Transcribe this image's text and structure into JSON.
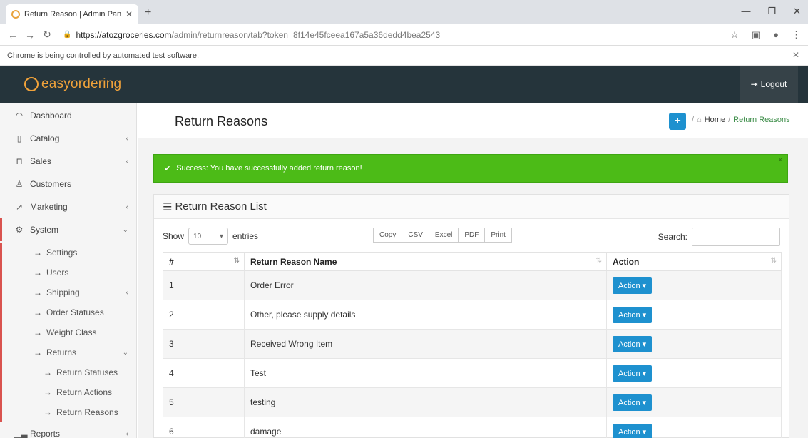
{
  "browser": {
    "tab_title": "Return Reason | Admin Panel - P",
    "url_host": "https://atozgroceries.com",
    "url_path": "/admin/returnreason/tab?token=8f14e45fceea167a5a36dedd4bea2543",
    "automation_notice": "Chrome is being controlled by automated test software."
  },
  "header": {
    "logo_text": "easyordering",
    "logout_label": "Logout"
  },
  "sidebar": {
    "items": [
      {
        "label": "Dashboard"
      },
      {
        "label": "Catalog"
      },
      {
        "label": "Sales"
      },
      {
        "label": "Customers"
      },
      {
        "label": "Marketing"
      },
      {
        "label": "System"
      },
      {
        "label": "Settings"
      },
      {
        "label": "Users"
      },
      {
        "label": "Shipping"
      },
      {
        "label": "Order Statuses"
      },
      {
        "label": "Weight Class"
      },
      {
        "label": "Returns"
      },
      {
        "label": "Return Statuses"
      },
      {
        "label": "Return Actions"
      },
      {
        "label": "Return Reasons"
      },
      {
        "label": "Reports"
      }
    ]
  },
  "page": {
    "title": "Return Reasons",
    "breadcrumb_home": "Home",
    "breadcrumb_current": "Return Reasons",
    "alert": "Success: You have successfully added return reason!"
  },
  "panel": {
    "title": "Return Reason List",
    "show_label": "Show",
    "show_value": "10",
    "entries_label": "entries",
    "buttons": [
      "Copy",
      "CSV",
      "Excel",
      "PDF",
      "Print"
    ],
    "search_label": "Search:",
    "columns": [
      "#",
      "Return Reason Name",
      "Action"
    ],
    "rows": [
      {
        "num": "1",
        "name": "Order Error",
        "action": "Action"
      },
      {
        "num": "2",
        "name": "Other, please supply details",
        "action": "Action"
      },
      {
        "num": "3",
        "name": "Received Wrong Item",
        "action": "Action"
      },
      {
        "num": "4",
        "name": "Test",
        "action": "Action"
      },
      {
        "num": "5",
        "name": "testing",
        "action": "Action"
      },
      {
        "num": "6",
        "name": "damage",
        "action": "Action"
      }
    ]
  }
}
